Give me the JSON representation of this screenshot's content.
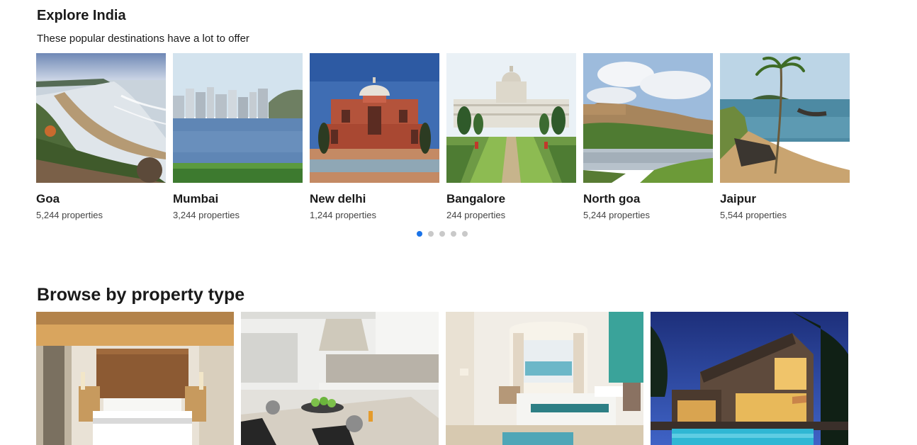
{
  "explore": {
    "title": "Explore India",
    "subtitle": "These popular destinations have a lot to offer"
  },
  "destinations": [
    {
      "name": "Goa",
      "count": "5,244 properties"
    },
    {
      "name": "Mumbai",
      "count": "3,244 properties"
    },
    {
      "name": "New delhi",
      "count": "1,244 properties"
    },
    {
      "name": "Bangalore",
      "count": "244 properties"
    },
    {
      "name": "North goa",
      "count": "5,244 properties"
    },
    {
      "name": "Jaipur",
      "count": "5,544 properties"
    }
  ],
  "carousel": {
    "page_count": 5,
    "active_page": 1,
    "active_color": "#1a73e8",
    "inactive_color": "#c9c9c9"
  },
  "browse": {
    "title": "Browse by property type"
  }
}
